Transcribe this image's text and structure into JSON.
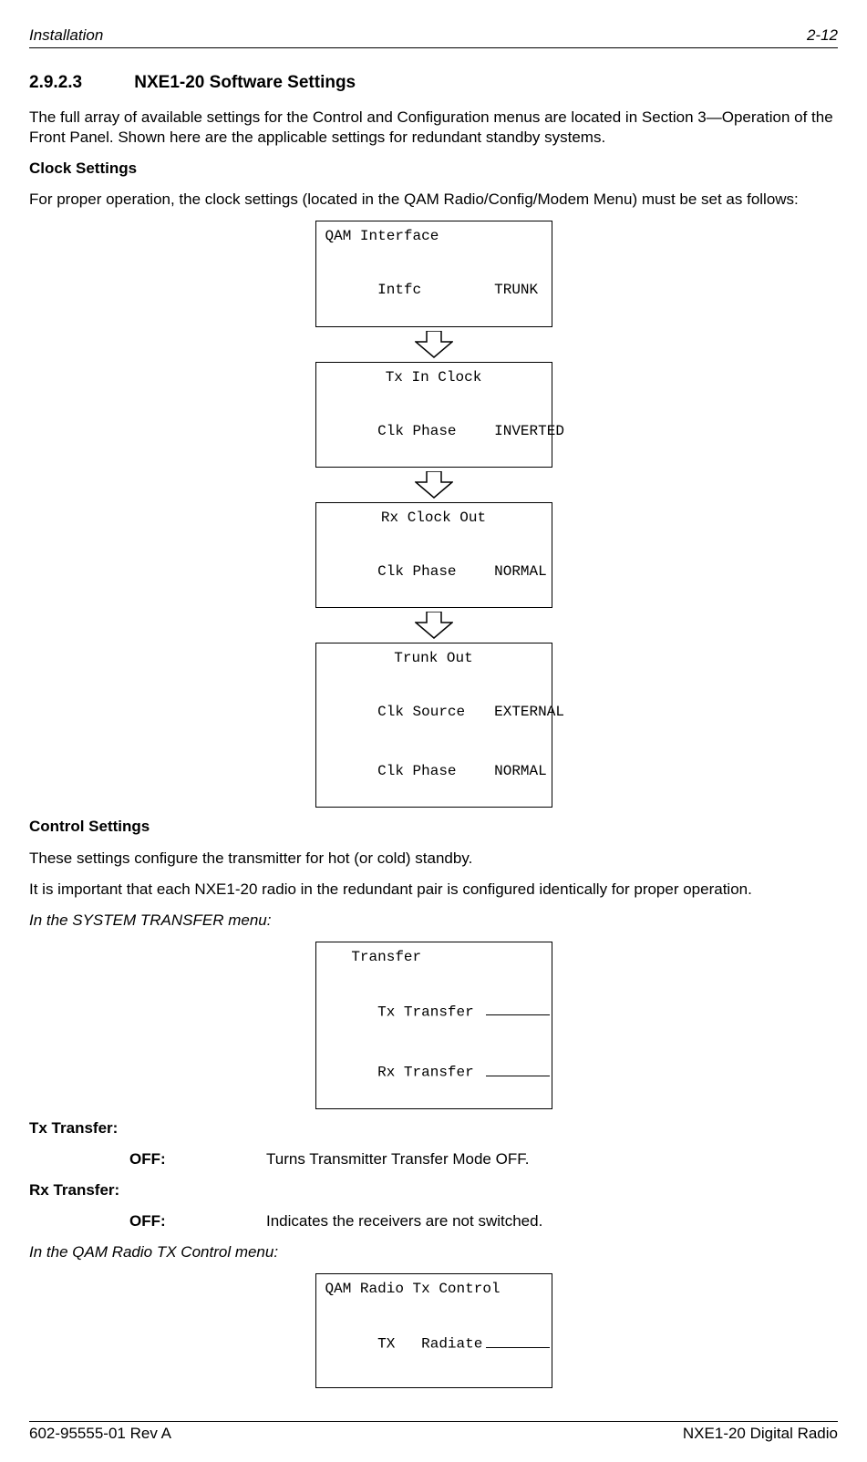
{
  "header": {
    "left": "Installation",
    "right": "2-12"
  },
  "section": {
    "number": "2.9.2.3",
    "title": "NXE1-20 Software Settings"
  },
  "intro": "The full array of available settings for the Control and Configuration menus are located in Section 3—Operation of the Front Panel.  Shown here are the applicable settings for redundant standby systems.",
  "clock": {
    "heading": "Clock Settings",
    "lead": "For proper operation, the clock settings (located in the QAM Radio/Config/Modem Menu) must be set as follows:",
    "box1": {
      "title": "QAM Interface",
      "row1_label": "Intfc",
      "row1_value": "TRUNK"
    },
    "box2": {
      "title": "Tx In Clock",
      "row1_label": "Clk Phase",
      "row1_value": "INVERTED"
    },
    "box3": {
      "title": "Rx Clock Out",
      "row1_label": "Clk Phase",
      "row1_value": "NORMAL"
    },
    "box4": {
      "title": "Trunk Out",
      "row1_label": "Clk Source",
      "row1_value": "EXTERNAL",
      "row2_label": "Clk Phase",
      "row2_value": "NORMAL"
    }
  },
  "control": {
    "heading": "Control Settings",
    "para1": "These settings configure the transmitter for hot (or cold) standby.",
    "para2": "It is important that each NXE1-20 radio in the redundant pair is configured identically for proper operation.",
    "menu_transfer_lead": "In the SYSTEM TRANSFER menu:",
    "transfer_box": {
      "title": "Transfer",
      "row1_label": "Tx Transfer",
      "row2_label": "Rx Transfer"
    },
    "tx_heading": "Tx Transfer:",
    "tx_off_term": "OFF:",
    "tx_off_desc": "Turns Transmitter Transfer Mode OFF.",
    "rx_heading": "Rx Transfer:",
    "rx_off_term": "OFF:",
    "rx_off_desc": "Indicates the receivers are not switched.",
    "menu_txctrl_lead": "In the QAM Radio TX Control menu:",
    "txctrl_box": {
      "title": "QAM Radio Tx Control",
      "row1_label": "TX   Radiate"
    }
  },
  "footer": {
    "left": "602-95555-01 Rev A",
    "right": "NXE1-20 Digital Radio"
  }
}
